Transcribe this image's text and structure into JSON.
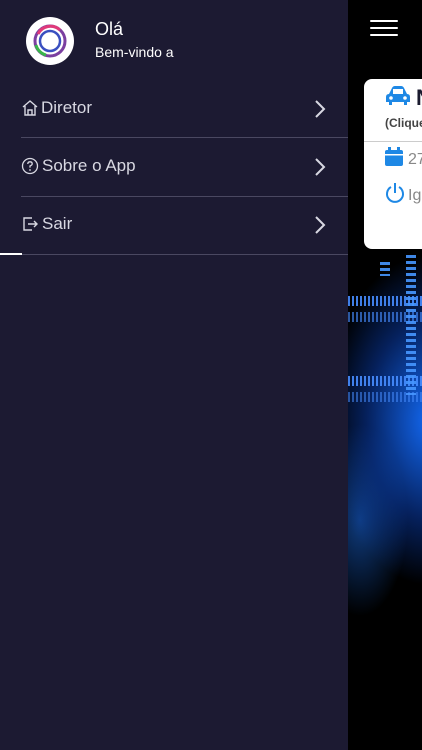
{
  "drawer": {
    "greeting": "Olá",
    "welcome": "Bem-vindo a",
    "items": [
      {
        "label": "Diretor",
        "icon": "home-icon"
      },
      {
        "label": "Sobre o App",
        "icon": "help-circle-icon"
      },
      {
        "label": "Sair",
        "icon": "logout-icon"
      }
    ]
  },
  "background_card": {
    "title": "N",
    "subtitle": "(Clique",
    "date": "27",
    "ignition": "Ig"
  },
  "colors": {
    "drawer_bg": "#1c1a32",
    "accent_blue": "#1e88e5",
    "card_bg": "#ffffff"
  }
}
